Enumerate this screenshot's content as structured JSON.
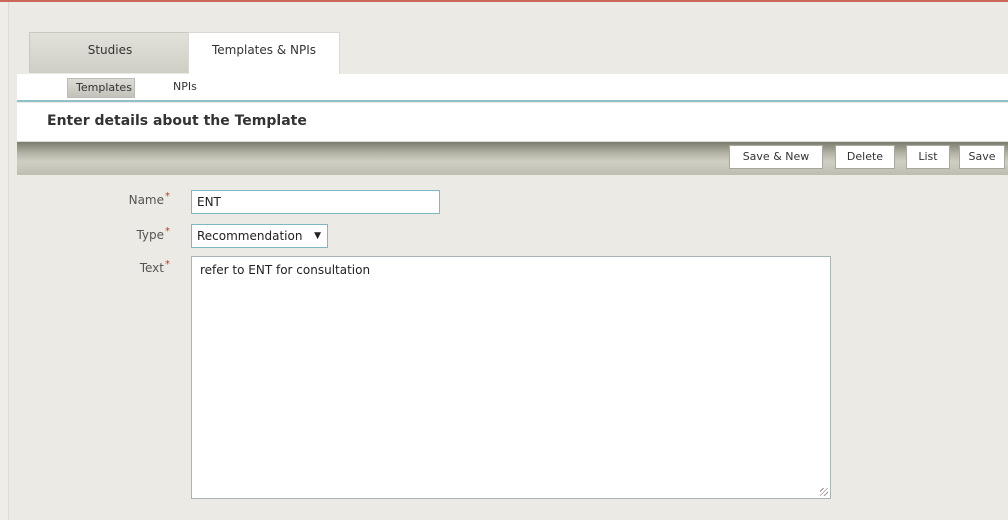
{
  "tabs": [
    {
      "label": "Studies"
    },
    {
      "label": "Templates & NPIs"
    }
  ],
  "subtabs": [
    {
      "label": "Templates"
    },
    {
      "label": "NPIs"
    }
  ],
  "section": {
    "title": "Enter details about the Template"
  },
  "toolbar": {
    "save_new_label": "Save & New",
    "delete_label": "Delete",
    "list_label": "List",
    "save_label": "Save"
  },
  "form": {
    "name_label": "Name",
    "name_value": "ENT",
    "type_label": "Type",
    "type_value": "Recommendation",
    "text_label": "Text",
    "text_value": "refer to ENT for consultation",
    "required_marker": "*"
  },
  "colors": {
    "accent_border": "#7fb8c4",
    "required": "#c0392b",
    "top_line": "#c9695c"
  }
}
